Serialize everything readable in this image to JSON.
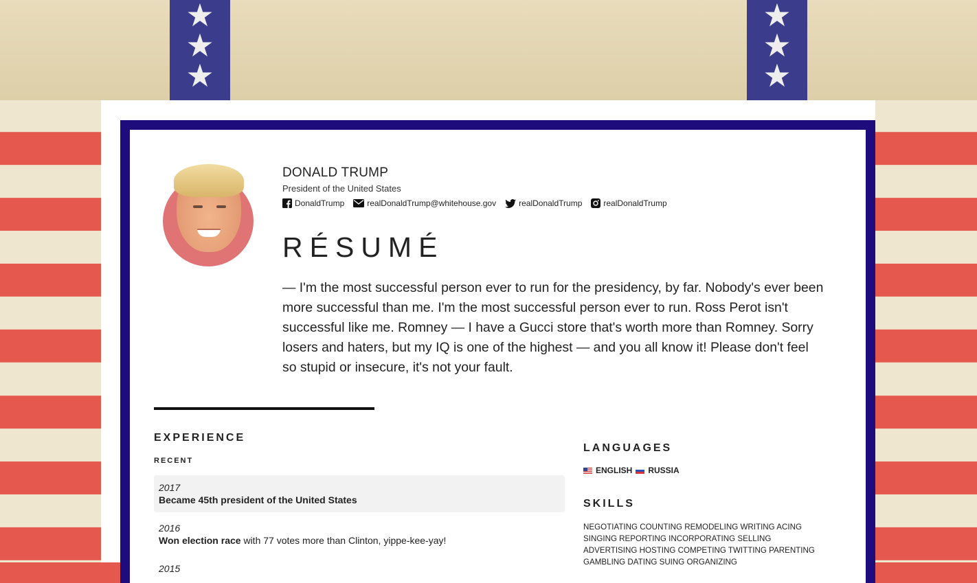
{
  "header": {
    "name": "DONALD TRUMP",
    "title": "President of the United States",
    "contacts": [
      {
        "icon": "facebook-icon",
        "label": "DonaldTrump"
      },
      {
        "icon": "envelope-icon",
        "label": "realDonaldTrump@whitehouse.gov"
      },
      {
        "icon": "twitter-icon",
        "label": "realDonaldTrump"
      },
      {
        "icon": "instagram-icon",
        "label": "realDonaldTrump"
      }
    ]
  },
  "resume": {
    "heading": "RÉSUMÉ",
    "quote": "— I'm the most successful person ever to run for the presidency, by far. Nobody's ever been more successful than me. I'm the most successful person ever to run. Ross Perot isn't successful like me. Romney — I have a Gucci store that's worth more than Romney. Sorry losers and haters, but my IQ is one of the highest — and you all know it! Please don't feel so stupid or insecure, it's not your fault."
  },
  "experience": {
    "title": "EXPERIENCE",
    "subtitle": "RECENT",
    "items": [
      {
        "year": "2017",
        "bold": "Became 45th president of the United States",
        "rest": ""
      },
      {
        "year": "2016",
        "bold": "Won election race",
        "rest": " with 77 votes more than Clinton, yippe-kee-yay!"
      },
      {
        "year": "2015",
        "bold": "",
        "rest": ""
      }
    ]
  },
  "languages": {
    "title": "LANGUAGES",
    "items": [
      {
        "flag": "us-flag",
        "label": "ENGLISH"
      },
      {
        "flag": "russia-flag",
        "label": "RUSSIA"
      }
    ]
  },
  "skills": {
    "title": "SKILLS",
    "text": "NEGOTIATING COUNTING REMODELING WRITING ACING SINGING REPORTING INCORPORATING SELLING ADVERTISING HOSTING COMPETING TWITTING PARENTING GAMBLING DATING SUING ORGANIZING"
  },
  "colors": {
    "frame": "#1e0b7c",
    "stripe_red": "#e4584d",
    "avatar_bg": "#e07474"
  }
}
